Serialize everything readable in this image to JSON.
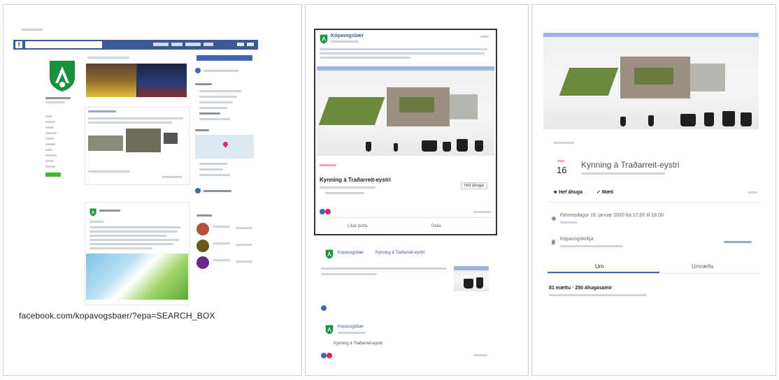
{
  "panel1": {
    "fb_logo": "f",
    "url_caption": "facebook.com/kopavogsbaer/?epa=SEARCH_BOX",
    "brand_blue": "#3b5998",
    "brand_green": "#42b72a"
  },
  "panel2": {
    "page_name": "Kópavogsbær",
    "event_title": "Kynning á Traðarreit-eystri",
    "interested_label": "Hef áhuga",
    "like_label": "Líkar þetta",
    "share_label": "Deila",
    "shared_page": "Kópavogsbær",
    "shared_event": "Kynning á Traðarreit-eystri",
    "second_page": "Kópavogsbær",
    "second_event": "Kynning á Traðarreit-eystri"
  },
  "panel3": {
    "day": "16",
    "event_title": "Kynning á Traðarreit-eystri",
    "interested_btn": "Hef áhuga",
    "going_btn": "Mæti",
    "time_text": "Fimmtudagur 16. janúar 2020 frá 17:00 til 18:00",
    "location": "Kópavogskirkja",
    "tab_about": "Um",
    "tab_discussion": "Umræða",
    "stats": "81 mættu · 250 áhugasamir"
  }
}
